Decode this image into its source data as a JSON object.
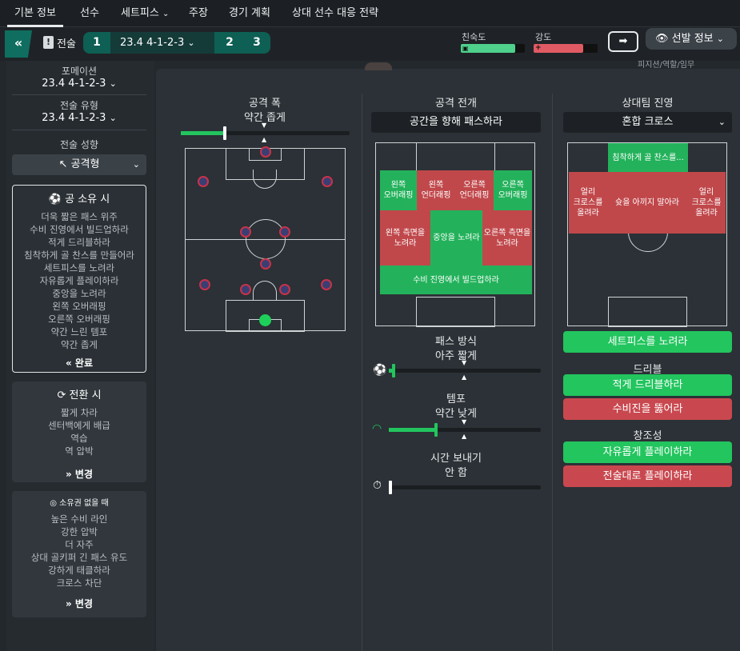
{
  "nav": {
    "tabs": [
      "기본 정보",
      "선수",
      "세트피스",
      "주장",
      "경기 계획",
      "상대 선수 대응 전략"
    ],
    "dropdown_arrow": "chevron-down-icon"
  },
  "subbar": {
    "back_label": "«",
    "tactic_label": "전술",
    "tactic_icon": "!",
    "slot1": "1",
    "current_tactic": "23.4 4-1-2-3",
    "slot2": "2",
    "slot3": "3",
    "familiarity_label": "친숙도",
    "intensity_label": "강도",
    "familiarity_level": 0.85,
    "intensity_level": 0.78,
    "familiarity_color": "#4fd08c",
    "intensity_color": "#e05a63",
    "arrow_btn": "➡",
    "info_btn": "선발 정보",
    "right_peek": "피지션/역할/임무"
  },
  "sidebar": {
    "formation_label": "포메이션",
    "formation_value": "23.4 4-1-2-3",
    "tactic_type_label": "전술 유형",
    "tactic_type_value": "23.4 4-1-2-3",
    "mentality_label": "전술 성향",
    "mentality_value": "공격형",
    "in_possession": {
      "title": "공 소유 시",
      "items": [
        "더욱 짧은 패스 위주",
        "수비 진영에서 빌드업하라",
        "적게 드리블하라",
        "침착하게 골 찬스를 만들어라",
        "세트피스를 노려라",
        "자유롭게 플레이하라",
        "중앙을 노려라",
        "왼쪽 오버래핑",
        "오른쪽 오버래핑",
        "약간 느린 템포",
        "약간 좁게"
      ],
      "footer": "완료"
    },
    "in_transition": {
      "title": "전환 시",
      "items": [
        "짧게 차라",
        "센터백에게 배급",
        "역습",
        "역 압박"
      ],
      "footer": "변경"
    },
    "out_possession": {
      "title": "소유권 없을 때",
      "items": [
        "높은 수비 라인",
        "강한 압박",
        "더 자주",
        "상대 골키퍼 긴 패스 유도",
        "강하게 태클하라",
        "크로스 차단"
      ],
      "footer": "변경"
    }
  },
  "col1": {
    "title": "공격 폭",
    "value": "약간 좁게",
    "slider_level": 0.25
  },
  "col2": {
    "title": "공격 전개",
    "select_value": "공간을 향해 패스하라",
    "zones": {
      "lw_overlap": "왼쪽\n오버래핑",
      "l_underlap": "왼쪽\n언더래핑",
      "r_underlap": "오른쪽\n언더래핑",
      "rw_overlap": "오른쪽\n오버래핑",
      "l_flank": "왼쪽 측면을\n노려라",
      "center": "중앙을 노려라",
      "r_flank": "오른쪽 측면을\n노려라",
      "buildup": "수비 진영에서 빌드업하라"
    },
    "pass_label": "패스 방식",
    "pass_value": "아주 짧게",
    "pass_level": 0.02,
    "tempo_label": "템포",
    "tempo_value": "약간 낮게",
    "tempo_level": 0.3,
    "timewaste_label": "시간 보내기",
    "timewaste_value": "안 함",
    "timewaste_level": 0.0
  },
  "col3": {
    "title": "상대팀 진영",
    "select_value": "혼합 크로스",
    "zones": {
      "patient": "침착하게 골 찬스를...",
      "early_l": "얼리\n크로스를\n올려라",
      "shoot": "슛을 아끼지 말아라",
      "early_r": "얼리\n크로스를\n올려라"
    },
    "setpiece_btn": "세트피스를 노려라",
    "dribble_label": "드리블",
    "dribble_less": "적게 드리블하라",
    "dribble_run": "수비진을 뚫어라",
    "creative_label": "창조성",
    "creative_free": "자유롭게 플레이하라",
    "creative_disc": "전술대로 플레이하라"
  },
  "colors": {
    "accent_green": "#22c55e",
    "accent_red": "#c9484f",
    "teal": "#0e5f54"
  }
}
